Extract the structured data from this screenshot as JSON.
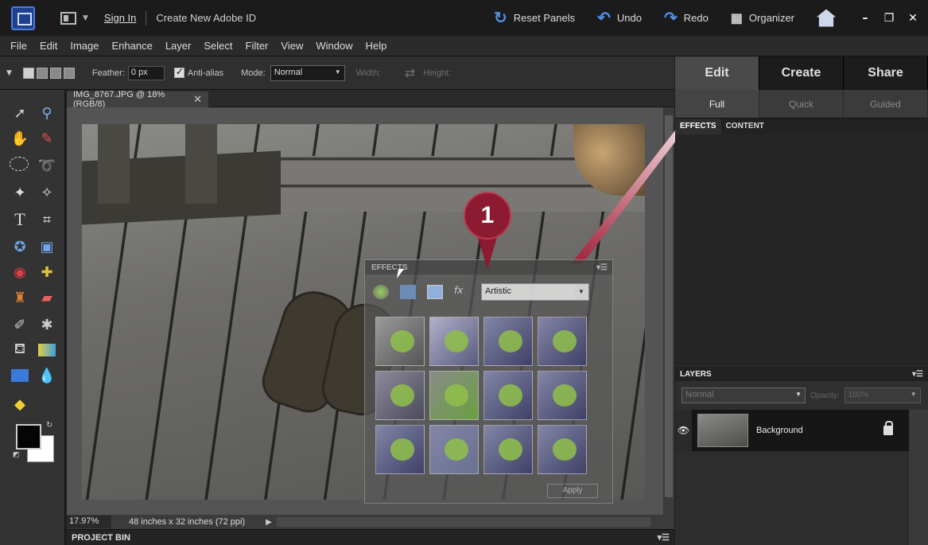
{
  "titlebar": {
    "sign_in": "Sign In",
    "create_id": "Create New Adobe ID",
    "reset_panels": "Reset Panels",
    "undo": "Undo",
    "redo": "Redo",
    "organizer": "Organizer"
  },
  "menubar": [
    "File",
    "Edit",
    "Image",
    "Enhance",
    "Layer",
    "Select",
    "Filter",
    "View",
    "Window",
    "Help"
  ],
  "options": {
    "feather_label": "Feather:",
    "feather_value": "0 px",
    "antialias_label": "Anti-alias",
    "mode_label": "Mode:",
    "mode_value": "Normal",
    "width_label": "Width:",
    "height_label": "Height:"
  },
  "document": {
    "tab_title": "IMG_8767.JPG @ 18% (RGB/8)",
    "zoom": "17.97%",
    "info": "48 inches x 32 inches (72 ppi)"
  },
  "project_bin": "PROJECT BIN",
  "effects_float": {
    "title": "EFFECTS",
    "category": "Artistic",
    "apply": "Apply"
  },
  "callout": "1",
  "right_panel": {
    "mode_tabs": [
      "Edit",
      "Create",
      "Share"
    ],
    "sub_tabs": [
      "Full",
      "Quick",
      "Guided"
    ],
    "panel_tabs": [
      "EFFECTS",
      "CONTENT"
    ],
    "layers_title": "LAYERS",
    "blend_mode": "Normal",
    "opacity_label": "Opacity:",
    "opacity_value": "100%",
    "layer_name": "Background"
  },
  "colors": {
    "accent_red": "#8c1a30",
    "panel_dark": "#2b2b2b",
    "foreground_color": "#050505",
    "background_color": "#ffffff"
  }
}
